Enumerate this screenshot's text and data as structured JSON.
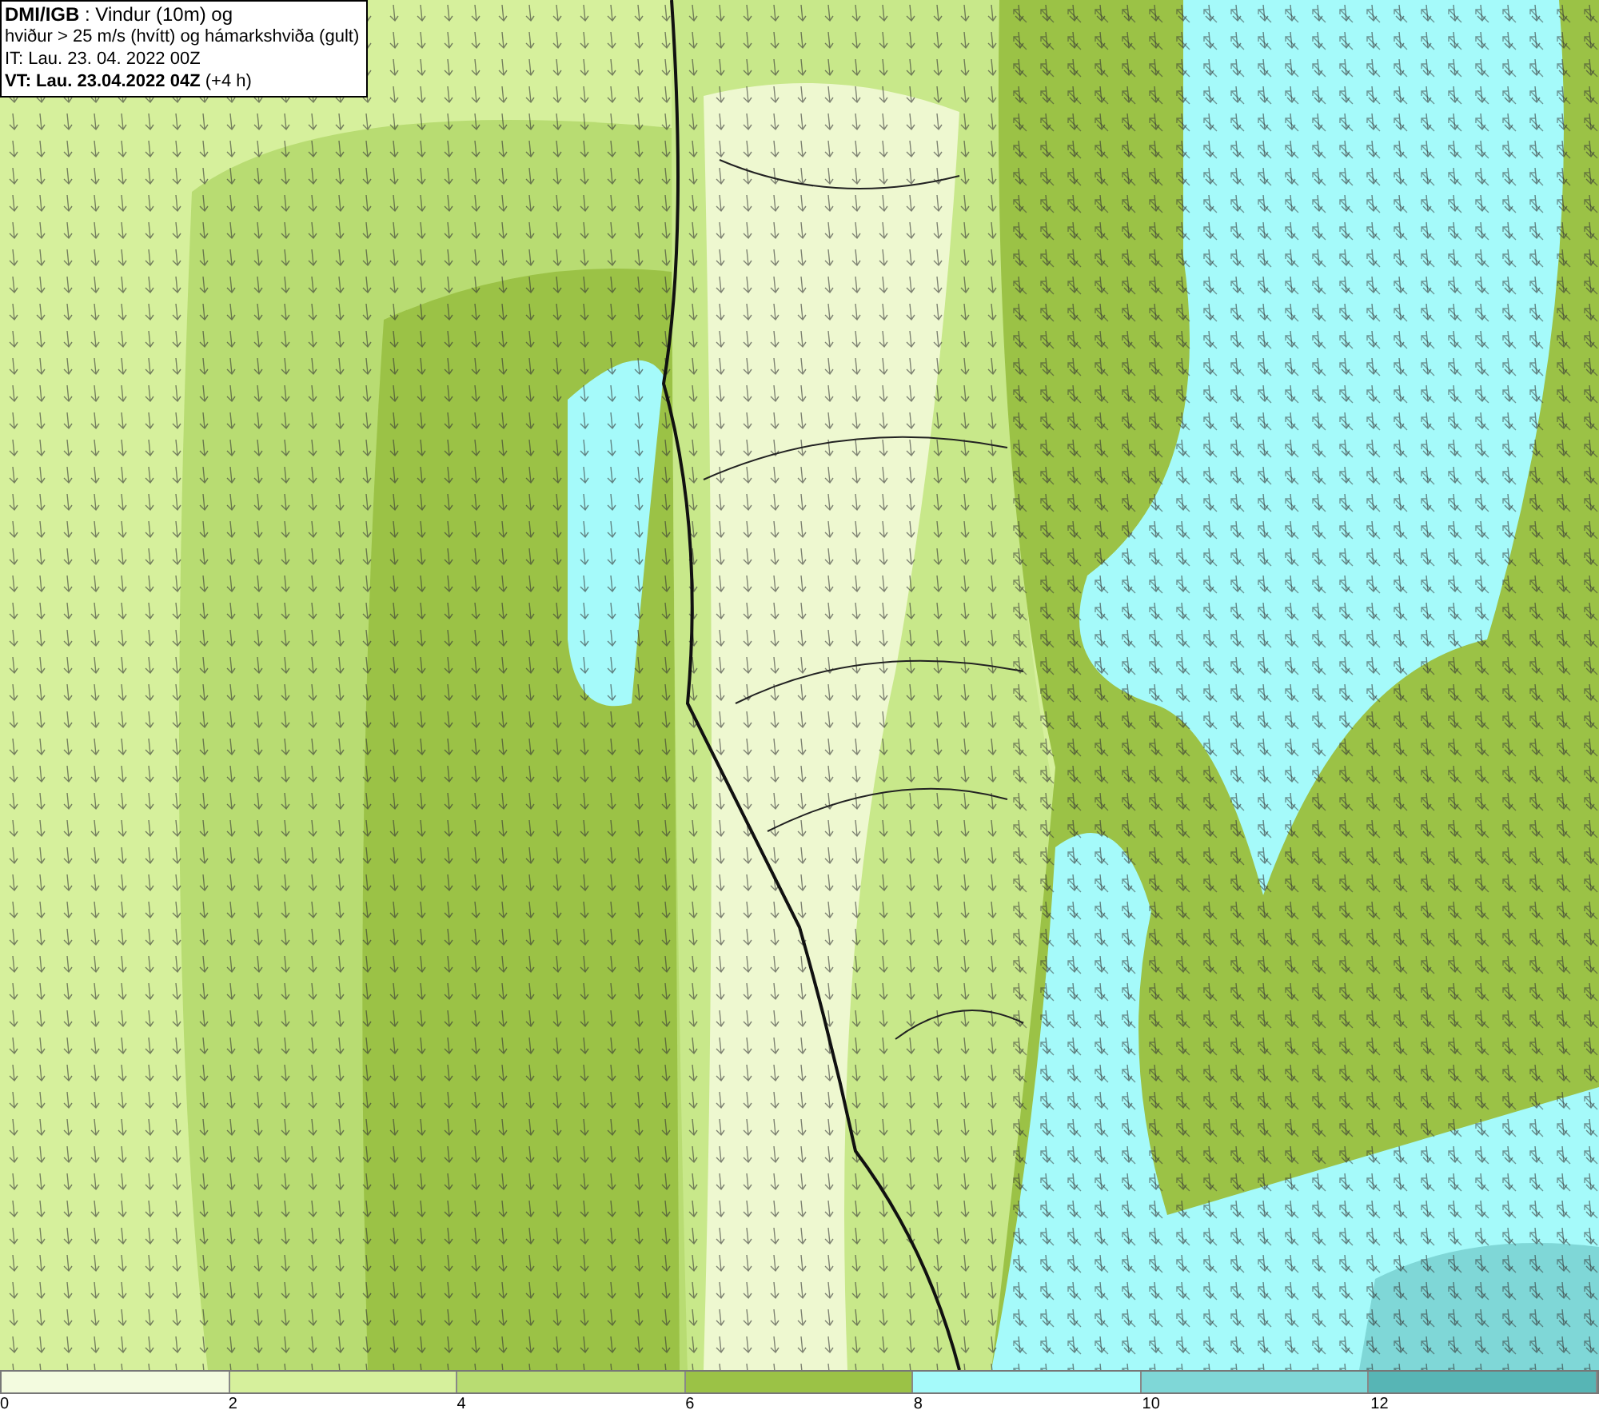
{
  "info_box": {
    "lines": [
      "**DMI/IGB** : Vindur (10m) og",
      "hviður > 25 m/s (hvítt) og hámarkshviða (gult)",
      "IT: Lau. 23. 04. 2022 00Z",
      "**VT: Lau. 23.04.2022 04Z** (+4 h)"
    ]
  },
  "legend": {
    "bins": [
      {
        "color": "#f3fbdf"
      },
      {
        "color": "#d6f09c"
      },
      {
        "color": "#b8dc72"
      },
      {
        "color": "#9bc246"
      },
      {
        "color": "#a5fafa"
      },
      {
        "color": "#7fd7d7"
      },
      {
        "color": "#57b5b5"
      }
    ],
    "ticks": [
      "0",
      "2",
      "4",
      "6",
      "8",
      "10",
      "12"
    ]
  }
}
